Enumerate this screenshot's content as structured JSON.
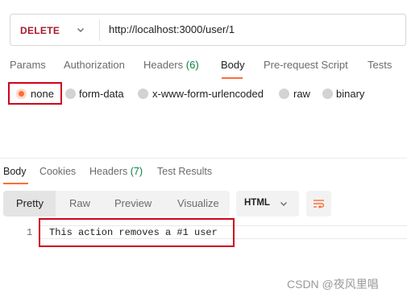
{
  "request": {
    "method": "DELETE",
    "url": "http://localhost:3000/user/1"
  },
  "request_tabs": [
    {
      "label": "Params"
    },
    {
      "label": "Authorization"
    },
    {
      "label": "Headers",
      "count": "(6)"
    },
    {
      "label": "Body",
      "active": true
    },
    {
      "label": "Pre-request Script"
    },
    {
      "label": "Tests"
    }
  ],
  "body_types": [
    {
      "label": "none",
      "selected": true
    },
    {
      "label": "form-data"
    },
    {
      "label": "x-www-form-urlencoded"
    },
    {
      "label": "raw"
    },
    {
      "label": "binary"
    }
  ],
  "response_tabs": [
    {
      "label": "Body",
      "active": true
    },
    {
      "label": "Cookies"
    },
    {
      "label": "Headers",
      "count": "(7)"
    },
    {
      "label": "Test Results"
    }
  ],
  "view_modes": [
    "Pretty",
    "Raw",
    "Preview",
    "Visualize"
  ],
  "active_view_mode": "Pretty",
  "format": "HTML",
  "response_body": {
    "line_number": "1",
    "text": "This action removes a #1 user"
  },
  "watermark": "CSDN @夜风里唱",
  "colors": {
    "accent": "#ff6c37",
    "highlight": "#d0021b",
    "count": "#0a7f3f",
    "method": "#a6192e"
  },
  "icons": [
    "chevron-down-icon",
    "wrap-lines-icon"
  ]
}
